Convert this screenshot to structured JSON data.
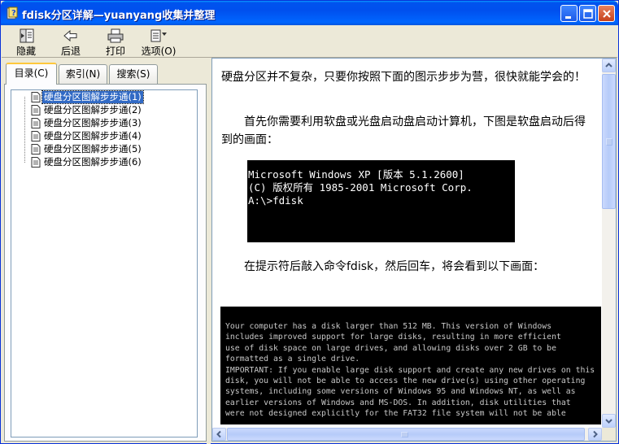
{
  "window": {
    "title": "fdisk分区详解—yuanyang收集并整理"
  },
  "toolbar": {
    "hide_label": "隐藏",
    "back_label": "后退",
    "print_label": "打印",
    "options_label": "选项(O)"
  },
  "tabs": [
    {
      "label": "目录(C)"
    },
    {
      "label": "索引(N)"
    },
    {
      "label": "搜索(S)"
    }
  ],
  "tree": {
    "items": [
      {
        "label": "硬盘分区图解步步通(1)"
      },
      {
        "label": "硬盘分区图解步步通(2)"
      },
      {
        "label": "硬盘分区图解步步通(3)"
      },
      {
        "label": "硬盘分区图解步步通(4)"
      },
      {
        "label": "硬盘分区图解步步通(5)"
      },
      {
        "label": "硬盘分区图解步步通(6)"
      }
    ]
  },
  "content": {
    "para1": "硬盘分区并不复杂，只要你按照下面的图示步步为营，很快就能学会的！",
    "para2": "　　首先你需要利用软盘或光盘启动盘启动计算机，下图是软盘启动后得到的画面：",
    "para3": "　　在提示符后敲入命令fdisk，然后回车，将会看到以下画面：",
    "console1": {
      "line1": "Microsoft Windows XP [版本 5.1.2600]",
      "line2": "(C) 版权所有 1985-2001 Microsoft Corp.",
      "line3": "",
      "line4": "A:\\>fdisk"
    },
    "console2": {
      "lines": [
        "Your computer has a disk larger than 512 MB. This version of Windows",
        "includes improved support for large disks, resulting in more efficient",
        "use of disk space on large drives, and allowing disks over 2 GB to be",
        "formatted as a single drive.",
        "",
        "IMPORTANT: If you enable large disk support and create any new drives on this",
        "disk, you will not be able to access the new drive(s) using other operating",
        "systems, including some versions of Windows 95 and Windows NT, as well as",
        "earlier versions of Windows and MS-DOS. In addition, disk utilities that",
        "were not designed explicitly for the FAT32 file system will not be able"
      ]
    }
  },
  "colors": {
    "titlebar": "#0055ea",
    "selection": "#316ac5",
    "tab_highlight": "#ffc83c"
  }
}
